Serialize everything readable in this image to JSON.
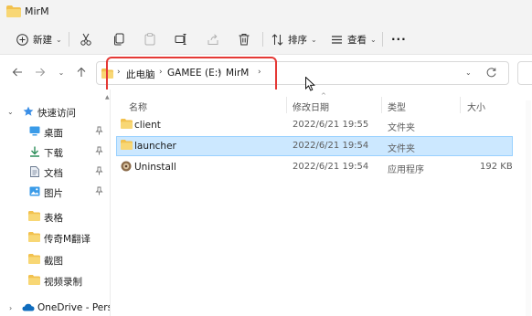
{
  "window": {
    "title": "MirM"
  },
  "toolbar": {
    "new_label": "新建",
    "sort_label": "排序",
    "view_label": "查看",
    "more_label": "···"
  },
  "address": {
    "crumbs": [
      "此电脑",
      "GAMEE (E:)",
      "MirM"
    ]
  },
  "sidebar": {
    "quick_access": "快速访问",
    "items": [
      {
        "label": "桌面",
        "icon": "desktop-icon",
        "pinned": true
      },
      {
        "label": "下载",
        "icon": "download-icon",
        "pinned": true
      },
      {
        "label": "文档",
        "icon": "document-icon",
        "pinned": true
      },
      {
        "label": "图片",
        "icon": "pictures-icon",
        "pinned": true
      },
      {
        "label": "表格",
        "icon": "folder-icon",
        "pinned": false
      },
      {
        "label": "传奇M翻译",
        "icon": "folder-icon",
        "pinned": false
      },
      {
        "label": "截图",
        "icon": "folder-icon",
        "pinned": false
      },
      {
        "label": "视频录制",
        "icon": "folder-icon",
        "pinned": false
      }
    ],
    "onedrive": "OneDrive - Persor"
  },
  "columns": {
    "name": "名称",
    "modified": "修改日期",
    "type": "类型",
    "size": "大小"
  },
  "files": [
    {
      "name": "client",
      "modified": "2022/6/21 19:55",
      "type": "文件夹",
      "size": "",
      "icon": "folder-icon",
      "selected": false
    },
    {
      "name": "launcher",
      "modified": "2022/6/21 19:54",
      "type": "文件夹",
      "size": "",
      "icon": "folder-icon",
      "selected": true
    },
    {
      "name": "Uninstall",
      "modified": "2022/6/21 19:54",
      "type": "应用程序",
      "size": "192 KB",
      "icon": "uninstall-app-icon",
      "selected": false
    }
  ],
  "colors": {
    "folder": "#f2c14e",
    "selection": "#cce8ff",
    "highlight": "#e53935",
    "accent": "#0067c0"
  }
}
